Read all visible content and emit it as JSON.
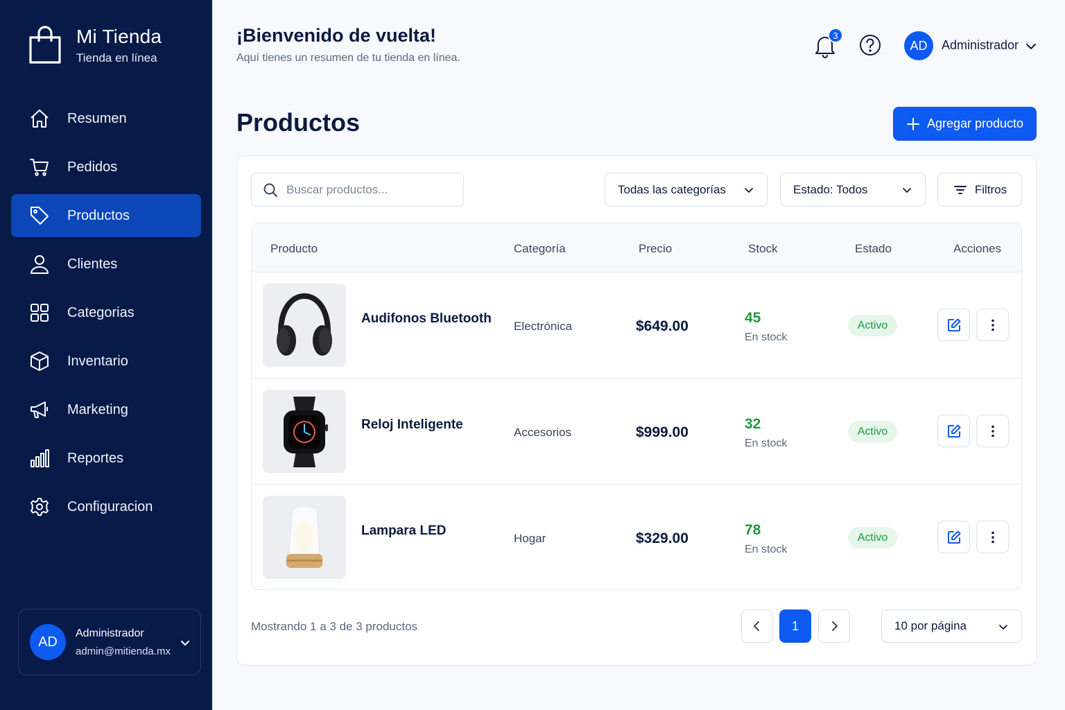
{
  "sidebar": {
    "brand_title": "Mi Tienda",
    "brand_subtitle": "Tienda en línea",
    "items": [
      {
        "label": "Resumen",
        "icon": "home-icon"
      },
      {
        "label": "Pedidos",
        "icon": "cart-icon"
      },
      {
        "label": "Productos",
        "icon": "tag-icon",
        "active": true
      },
      {
        "label": "Clientes",
        "icon": "user-icon"
      },
      {
        "label": "Categorias",
        "icon": "grid-icon"
      },
      {
        "label": "Inventario",
        "icon": "box-icon"
      },
      {
        "label": "Marketing",
        "icon": "megaphone-icon"
      },
      {
        "label": "Reportes",
        "icon": "bar-chart-icon"
      },
      {
        "label": "Configuracion",
        "icon": "gear-icon"
      }
    ],
    "user": {
      "initials": "AD",
      "name": "Administrador",
      "email": "admin@mitienda.mx"
    }
  },
  "header": {
    "welcome_title": "¡Bienvenido de vuelta!",
    "welcome_subtitle": "Aquí tienes un resumen de tu tienda en línea.",
    "notifications": "3",
    "user_initials": "AD",
    "user_name": "Administrador"
  },
  "page": {
    "title": "Productos",
    "add_button": "Agregar producto"
  },
  "toolbar": {
    "search_placeholder": "Buscar productos...",
    "category_select": "Todas las categorías",
    "status_select": "Estado: Todos",
    "filters_label": "Filtros"
  },
  "table": {
    "columns": [
      "Producto",
      "Categoría",
      "Precio",
      "Stock",
      "Estado",
      "Acciones"
    ],
    "rows": [
      {
        "name": "Audifonos Bluetooth",
        "category": "Electrónica",
        "price": "$649.00",
        "stock": "45",
        "stock_label": "En stock",
        "status": "Activo",
        "image": "headphones"
      },
      {
        "name": "Reloj Inteligente",
        "category": "Accesorios",
        "price": "$999.00",
        "stock": "32",
        "stock_label": "En stock",
        "status": "Activo",
        "image": "smartwatch"
      },
      {
        "name": "Lampara LED",
        "category": "Hogar",
        "price": "$329.00",
        "stock": "78",
        "stock_label": "En stock",
        "status": "Activo",
        "image": "lamp"
      }
    ]
  },
  "pagination": {
    "showing": "Mostrando 1 a 3 de 3 productos",
    "current_page": "1",
    "per_page": "10 por página"
  },
  "colors": {
    "sidebar_bg": "#071a48",
    "accent": "#0d5bf0",
    "active_nav": "#0c47b8",
    "success": "#1e9a3c"
  }
}
